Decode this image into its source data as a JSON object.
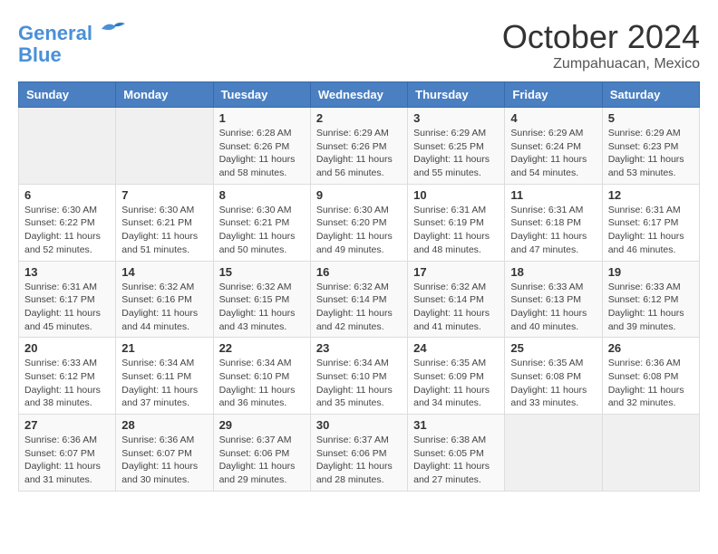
{
  "header": {
    "logo_line1": "General",
    "logo_line2": "Blue",
    "month_title": "October 2024",
    "location": "Zumpahuacan, Mexico"
  },
  "weekdays": [
    "Sunday",
    "Monday",
    "Tuesday",
    "Wednesday",
    "Thursday",
    "Friday",
    "Saturday"
  ],
  "weeks": [
    [
      {
        "day": "",
        "info": ""
      },
      {
        "day": "",
        "info": ""
      },
      {
        "day": "1",
        "info": "Sunrise: 6:28 AM\nSunset: 6:26 PM\nDaylight: 11 hours\nand 58 minutes."
      },
      {
        "day": "2",
        "info": "Sunrise: 6:29 AM\nSunset: 6:26 PM\nDaylight: 11 hours\nand 56 minutes."
      },
      {
        "day": "3",
        "info": "Sunrise: 6:29 AM\nSunset: 6:25 PM\nDaylight: 11 hours\nand 55 minutes."
      },
      {
        "day": "4",
        "info": "Sunrise: 6:29 AM\nSunset: 6:24 PM\nDaylight: 11 hours\nand 54 minutes."
      },
      {
        "day": "5",
        "info": "Sunrise: 6:29 AM\nSunset: 6:23 PM\nDaylight: 11 hours\nand 53 minutes."
      }
    ],
    [
      {
        "day": "6",
        "info": "Sunrise: 6:30 AM\nSunset: 6:22 PM\nDaylight: 11 hours\nand 52 minutes."
      },
      {
        "day": "7",
        "info": "Sunrise: 6:30 AM\nSunset: 6:21 PM\nDaylight: 11 hours\nand 51 minutes."
      },
      {
        "day": "8",
        "info": "Sunrise: 6:30 AM\nSunset: 6:21 PM\nDaylight: 11 hours\nand 50 minutes."
      },
      {
        "day": "9",
        "info": "Sunrise: 6:30 AM\nSunset: 6:20 PM\nDaylight: 11 hours\nand 49 minutes."
      },
      {
        "day": "10",
        "info": "Sunrise: 6:31 AM\nSunset: 6:19 PM\nDaylight: 11 hours\nand 48 minutes."
      },
      {
        "day": "11",
        "info": "Sunrise: 6:31 AM\nSunset: 6:18 PM\nDaylight: 11 hours\nand 47 minutes."
      },
      {
        "day": "12",
        "info": "Sunrise: 6:31 AM\nSunset: 6:17 PM\nDaylight: 11 hours\nand 46 minutes."
      }
    ],
    [
      {
        "day": "13",
        "info": "Sunrise: 6:31 AM\nSunset: 6:17 PM\nDaylight: 11 hours\nand 45 minutes."
      },
      {
        "day": "14",
        "info": "Sunrise: 6:32 AM\nSunset: 6:16 PM\nDaylight: 11 hours\nand 44 minutes."
      },
      {
        "day": "15",
        "info": "Sunrise: 6:32 AM\nSunset: 6:15 PM\nDaylight: 11 hours\nand 43 minutes."
      },
      {
        "day": "16",
        "info": "Sunrise: 6:32 AM\nSunset: 6:14 PM\nDaylight: 11 hours\nand 42 minutes."
      },
      {
        "day": "17",
        "info": "Sunrise: 6:32 AM\nSunset: 6:14 PM\nDaylight: 11 hours\nand 41 minutes."
      },
      {
        "day": "18",
        "info": "Sunrise: 6:33 AM\nSunset: 6:13 PM\nDaylight: 11 hours\nand 40 minutes."
      },
      {
        "day": "19",
        "info": "Sunrise: 6:33 AM\nSunset: 6:12 PM\nDaylight: 11 hours\nand 39 minutes."
      }
    ],
    [
      {
        "day": "20",
        "info": "Sunrise: 6:33 AM\nSunset: 6:12 PM\nDaylight: 11 hours\nand 38 minutes."
      },
      {
        "day": "21",
        "info": "Sunrise: 6:34 AM\nSunset: 6:11 PM\nDaylight: 11 hours\nand 37 minutes."
      },
      {
        "day": "22",
        "info": "Sunrise: 6:34 AM\nSunset: 6:10 PM\nDaylight: 11 hours\nand 36 minutes."
      },
      {
        "day": "23",
        "info": "Sunrise: 6:34 AM\nSunset: 6:10 PM\nDaylight: 11 hours\nand 35 minutes."
      },
      {
        "day": "24",
        "info": "Sunrise: 6:35 AM\nSunset: 6:09 PM\nDaylight: 11 hours\nand 34 minutes."
      },
      {
        "day": "25",
        "info": "Sunrise: 6:35 AM\nSunset: 6:08 PM\nDaylight: 11 hours\nand 33 minutes."
      },
      {
        "day": "26",
        "info": "Sunrise: 6:36 AM\nSunset: 6:08 PM\nDaylight: 11 hours\nand 32 minutes."
      }
    ],
    [
      {
        "day": "27",
        "info": "Sunrise: 6:36 AM\nSunset: 6:07 PM\nDaylight: 11 hours\nand 31 minutes."
      },
      {
        "day": "28",
        "info": "Sunrise: 6:36 AM\nSunset: 6:07 PM\nDaylight: 11 hours\nand 30 minutes."
      },
      {
        "day": "29",
        "info": "Sunrise: 6:37 AM\nSunset: 6:06 PM\nDaylight: 11 hours\nand 29 minutes."
      },
      {
        "day": "30",
        "info": "Sunrise: 6:37 AM\nSunset: 6:06 PM\nDaylight: 11 hours\nand 28 minutes."
      },
      {
        "day": "31",
        "info": "Sunrise: 6:38 AM\nSunset: 6:05 PM\nDaylight: 11 hours\nand 27 minutes."
      },
      {
        "day": "",
        "info": ""
      },
      {
        "day": "",
        "info": ""
      }
    ]
  ]
}
